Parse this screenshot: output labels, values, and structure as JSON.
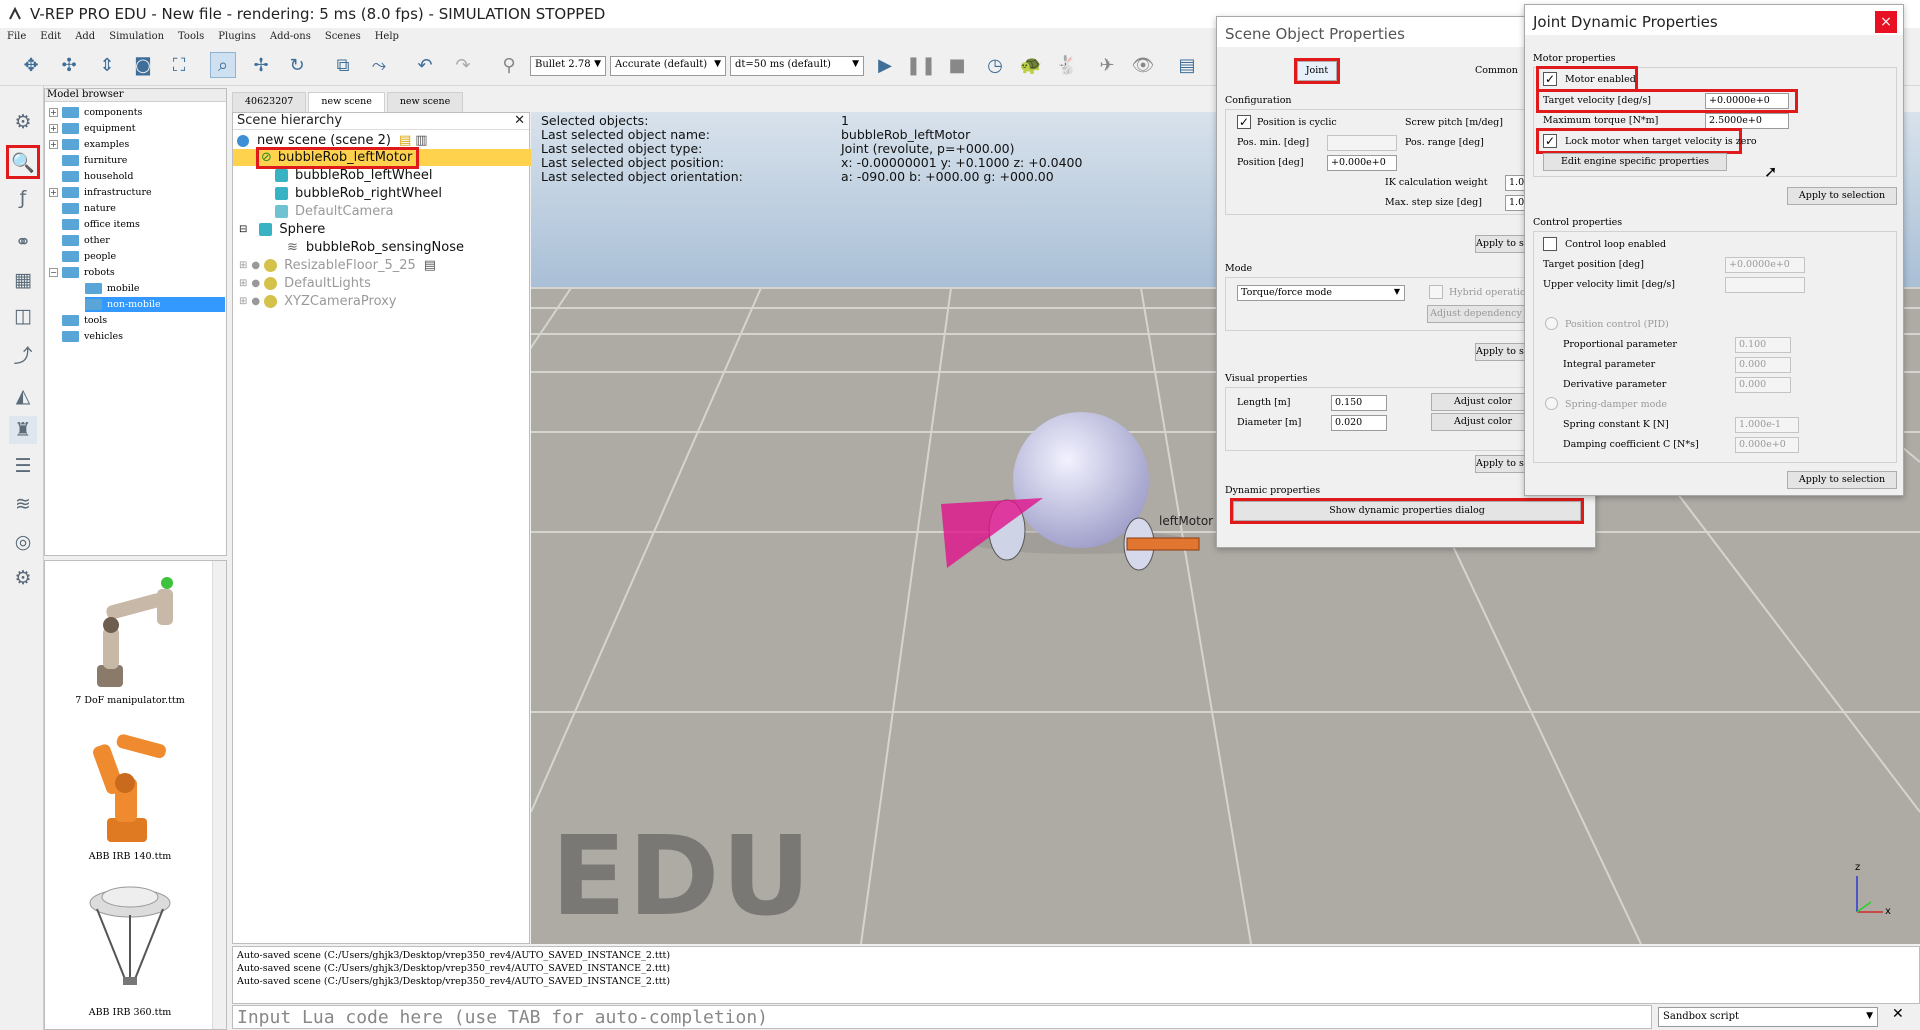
{
  "window": {
    "title": "V-REP PRO EDU - New file - rendering: 5 ms (8.0 fps) - SIMULATION STOPPED"
  },
  "menu": [
    "File",
    "Edit",
    "Add",
    "Simulation",
    "Tools",
    "Plugins",
    "Add-ons",
    "Scenes",
    "Help"
  ],
  "toolbar": {
    "engine": "Bullet 2.78",
    "accuracy": "Accurate (default)",
    "timestep": "dt=50 ms (default)"
  },
  "model_browser": {
    "header": "Model browser",
    "folders": [
      "components",
      "equipment",
      "examples",
      "furniture",
      "household",
      "infrastructure",
      "nature",
      "office items",
      "other",
      "people",
      "robots",
      "mobile",
      "non-mobile",
      "tools",
      "vehicles"
    ],
    "thumbnails": [
      "7 DoF manipulator.ttm",
      "ABB IRB 140.ttm",
      "ABB IRB 360.ttm"
    ]
  },
  "scene_tabs": [
    "40623207",
    "new scene",
    "new scene"
  ],
  "hierarchy": {
    "header": "Scene hierarchy",
    "root": "new scene (scene 2)",
    "items": [
      "bubbleRob_leftMotor",
      "bubbleRob_leftWheel",
      "bubbleRob_rightWheel",
      "DefaultCamera",
      "Sphere",
      "bubbleRob_sensingNose",
      "ResizableFloor_5_25",
      "DefaultLights",
      "XYZCameraProxy"
    ]
  },
  "viewport": {
    "info_labels": [
      "Selected objects:",
      "Last selected object name:",
      "Last selected object type:",
      "Last selected object position:",
      "Last selected object orientation:"
    ],
    "info_values": [
      "1",
      "bubbleRob_leftMotor",
      "Joint (revolute, p=+000.00)",
      "x: -0.00000001    y: +0.1000    z: +0.0400",
      "a: -090.00    b: +000.00    g: +000.00"
    ],
    "watermark": "EDU",
    "object_label": "leftMotor",
    "axis_z": "z",
    "axis_x": "x"
  },
  "console": {
    "lines": [
      "Auto-saved scene (C:/Users/ghjk3/Desktop/vrep350_rev4/AUTO_SAVED_INSTANCE_2.ttt)",
      "Auto-saved scene (C:/Users/ghjk3/Desktop/vrep350_rev4/AUTO_SAVED_INSTANCE_2.ttt)",
      "Auto-saved scene (C:/Users/ghjk3/Desktop/vrep350_rev4/AUTO_SAVED_INSTANCE_2.ttt)"
    ],
    "input_placeholder": "Input Lua code here (use TAB for auto-completion)",
    "script_mode": "Sandbox script"
  },
  "scene_props": {
    "title": "Scene Object Properties",
    "tab_joint": "Joint",
    "tab_common": "Common",
    "config_label": "Configuration",
    "cyclic": "Position is cyclic",
    "screw_pitch": "Screw pitch [m/deg]",
    "pos_min": "Pos. min. [deg]",
    "pos_range": "Pos. range [deg]",
    "position": "Position [deg]",
    "position_val": "+0.000e+0",
    "ik_weight": "IK calculation weight",
    "max_step": "Max. step size [deg]",
    "ik_val": "1.0",
    "step_val": "1.0",
    "apply": "Apply to selection",
    "mode_label": "Mode",
    "mode_value": "Torque/force mode",
    "hybrid": "Hybrid operation",
    "adjust_dep": "Adjust dependency",
    "visual_label": "Visual properties",
    "length": "Length [m]",
    "length_val": "0.150",
    "diameter": "Diameter [m]",
    "diameter_val": "0.020",
    "adjust_color": "Adjust color",
    "dynamic_label": "Dynamic properties",
    "show_dyn": "Show dynamic properties dialog"
  },
  "joint_dyn": {
    "title": "Joint Dynamic Properties",
    "motor_label": "Motor properties",
    "motor_enabled": "Motor enabled",
    "target_vel": "Target velocity [deg/s]",
    "target_vel_val": "+0.0000e+0",
    "max_torque": "Maximum torque [N*m]",
    "max_torque_val": "2.5000e+0",
    "lock_motor": "Lock motor when target velocity is zero",
    "edit_engine": "Edit engine specific properties",
    "apply": "Apply to selection",
    "control_label": "Control properties",
    "control_loop": "Control loop enabled",
    "target_pos": "Target position [deg]",
    "target_pos_val": "+0.0000e+0",
    "upper_vel": "Upper velocity limit [deg/s]",
    "pid": "Position control (PID)",
    "p_param": "Proportional parameter",
    "p_val": "0.100",
    "i_param": "Integral parameter",
    "i_val": "0.000",
    "d_param": "Derivative parameter",
    "d_val": "0.000",
    "spring": "Spring-damper mode",
    "spring_k": "Spring constant K [N]",
    "spring_k_val": "1.000e-1",
    "damping": "Damping coefficient C [N*s]",
    "damping_val": "0.000e+0",
    "close": "×"
  },
  "colors": {
    "highlight": "#e01a1a",
    "selection": "#ffd24d",
    "sky": "#bcd0e4",
    "floor": "#b8b6b1"
  }
}
